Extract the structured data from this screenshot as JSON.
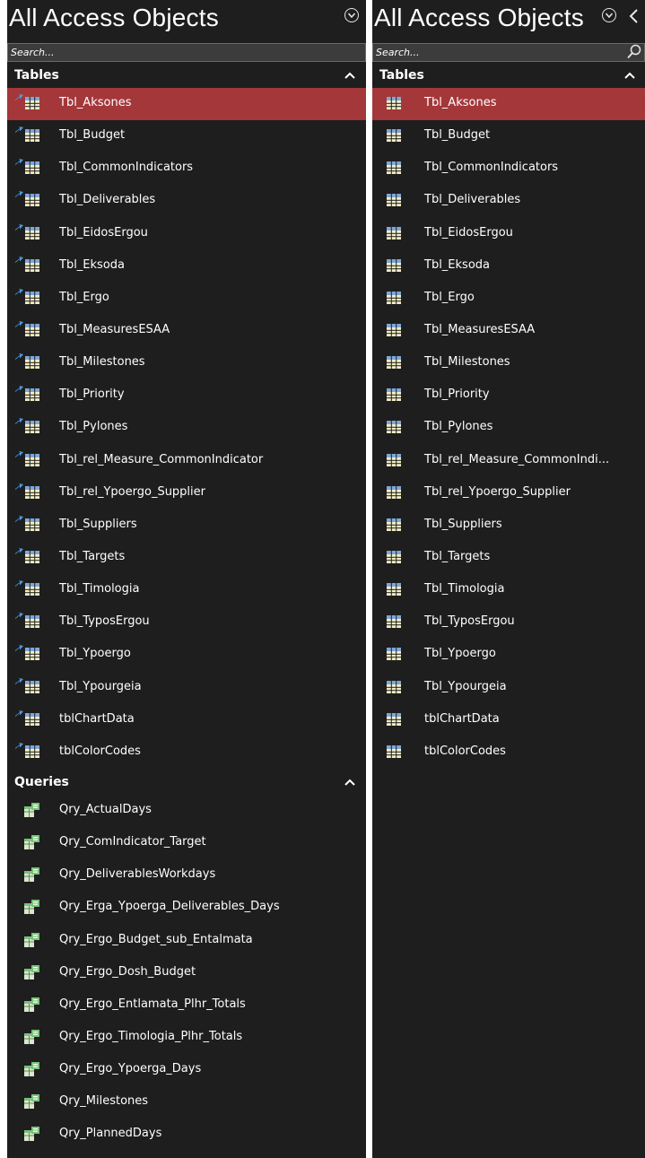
{
  "left_pane": {
    "title": "All Access Objects",
    "search_placeholder": "Search...",
    "groups": [
      {
        "label": "Tables",
        "items": [
          "Tbl_Aksones",
          "Tbl_Budget",
          "Tbl_CommonIndicators",
          "Tbl_Deliverables",
          "Tbl_EidosErgou",
          "Tbl_Eksoda",
          "Tbl_Ergo",
          "Tbl_MeasuresESAA",
          "Tbl_Milestones",
          "Tbl_Priority",
          "Tbl_Pylones",
          "Tbl_rel_Measure_CommonIndicator",
          "Tbl_rel_Ypoergo_Supplier",
          "Tbl_Suppliers",
          "Tbl_Targets",
          "Tbl_Timologia",
          "Tbl_TyposErgou",
          "Tbl_Ypoergo",
          "Tbl_Ypourgeia",
          "tblChartData",
          "tblColorCodes"
        ]
      },
      {
        "label": "Queries",
        "items": [
          "Qry_ActualDays",
          "Qry_ComIndicator_Target",
          "Qry_DeliverablesWorkdays",
          "Qry_Erga_Ypoerga_Deliverables_Days",
          "Qry_Ergo_Budget_sub_Entalmata",
          "Qry_Ergo_Dosh_Budget",
          "Qry_Ergo_Entlamata_Plhr_Totals",
          "Qry_Ergo_Timologia_Plhr_Totals",
          "Qry_Ergo_Ypoerga_Days",
          "Qry_Milestones",
          "Qry_PlannedDays"
        ]
      }
    ]
  },
  "right_pane": {
    "title": "All Access Objects",
    "search_placeholder": "Search...",
    "groups": [
      {
        "label": "Tables",
        "items": [
          "Tbl_Aksones",
          "Tbl_Budget",
          "Tbl_CommonIndicators",
          "Tbl_Deliverables",
          "Tbl_EidosErgou",
          "Tbl_Eksoda",
          "Tbl_Ergo",
          "Tbl_MeasuresESAA",
          "Tbl_Milestones",
          "Tbl_Priority",
          "Tbl_Pylones",
          "Tbl_rel_Measure_CommonIndi...",
          "Tbl_rel_Ypoergo_Supplier",
          "Tbl_Suppliers",
          "Tbl_Targets",
          "Tbl_Timologia",
          "Tbl_TyposErgou",
          "Tbl_Ypoergo",
          "Tbl_Ypourgeia",
          "tblChartData",
          "tblColorCodes"
        ]
      }
    ]
  },
  "selected_item": "Tbl_Aksones",
  "colors": {
    "pane_background": "#1e1e1e",
    "selection": "#a4373a",
    "table_icon": "#f3eec6",
    "table_icon_header": "#7fa7d8",
    "link_arrow": "#4aa0ee",
    "query_icon": "#7ac27a"
  },
  "icons": {
    "collapse_pane": "circle-chevron-down-icon",
    "group_toggle": "chevron-up-icon",
    "table": "table-icon",
    "linked_table": "link-arrow-icon",
    "query": "query-icon",
    "search": "search-icon"
  }
}
